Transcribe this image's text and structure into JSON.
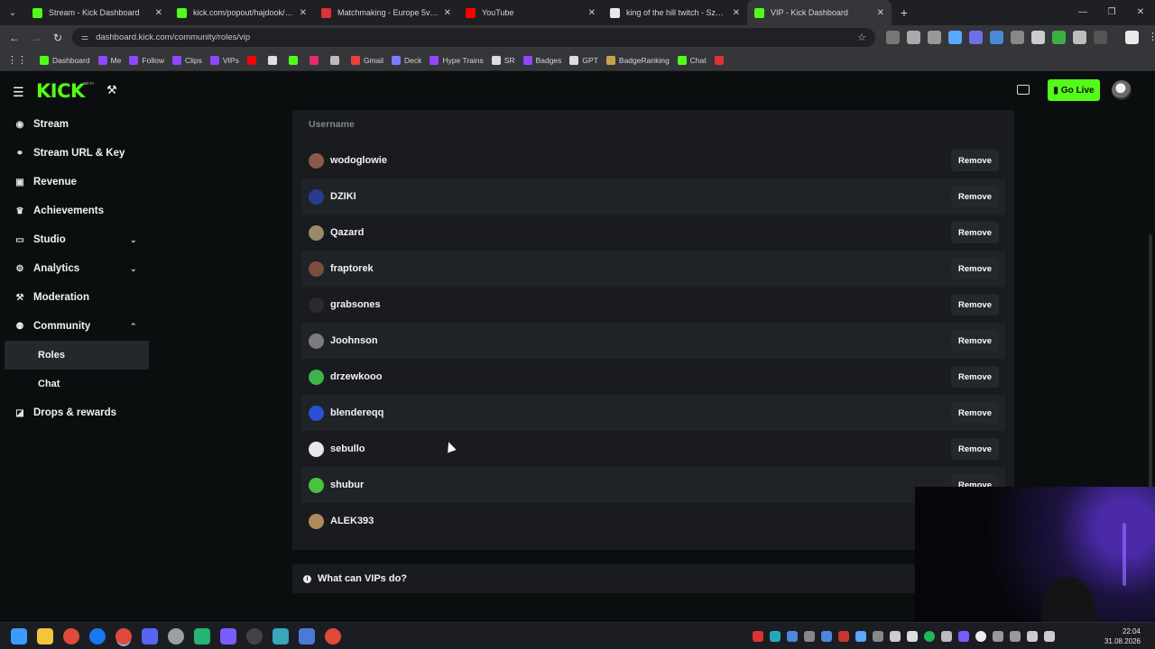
{
  "browser": {
    "tabs": [
      {
        "title": "Stream - Kick Dashboard",
        "color": "#53fc18",
        "active": false
      },
      {
        "title": "kick.com/popout/hajdook/chat",
        "color": "#53fc18",
        "active": false
      },
      {
        "title": "Matchmaking - Europe 5v5 Qu",
        "color": "#d33",
        "active": false
      },
      {
        "title": "YouTube",
        "color": "#ff0000",
        "active": false
      },
      {
        "title": "king of the hill twitch - Szukaj w",
        "color": "#e8e8e8",
        "active": false
      },
      {
        "title": "VIP - Kick Dashboard",
        "color": "#53fc18",
        "active": true
      }
    ],
    "url": "dashboard.kick.com/community/roles/vip",
    "bookmarks": [
      {
        "label": "Dashboard",
        "color": "#53fc18"
      },
      {
        "label": "Me",
        "color": "#9146ff"
      },
      {
        "label": "Follow",
        "color": "#9146ff"
      },
      {
        "label": "Clips",
        "color": "#9146ff"
      },
      {
        "label": "VIPs",
        "color": "#9146ff"
      },
      {
        "label": "",
        "color": "#ff0000"
      },
      {
        "label": "",
        "color": "#e0e0e0"
      },
      {
        "label": "",
        "color": "#53fc18"
      },
      {
        "label": "",
        "color": "#e1306c"
      },
      {
        "label": "",
        "color": "#bbbbbb"
      },
      {
        "label": "Gmail",
        "color": "#ea4335"
      },
      {
        "label": "Deck",
        "color": "#7b7bff"
      },
      {
        "label": "Hype Trains",
        "color": "#9146ff"
      },
      {
        "label": "SR",
        "color": "#dddddd"
      },
      {
        "label": "Badges",
        "color": "#9146ff"
      },
      {
        "label": "GPT",
        "color": "#dddddd"
      },
      {
        "label": "BadgeRanking",
        "color": "#c8a24a"
      },
      {
        "label": "Chat",
        "color": "#53fc18"
      },
      {
        "label": "",
        "color": "#d33"
      }
    ]
  },
  "kick": {
    "logo": "KICK",
    "beta": "BETA",
    "go_live": "Go Live",
    "sidebar": [
      {
        "label": "Stream",
        "icon": "◉",
        "name": "stream"
      },
      {
        "label": "Stream URL & Key",
        "icon": "⚭",
        "name": "stream-url-key"
      },
      {
        "label": "Revenue",
        "icon": "▣",
        "name": "revenue"
      },
      {
        "label": "Achievements",
        "icon": "♛",
        "name": "achievements"
      },
      {
        "label": "Studio",
        "icon": "▭",
        "name": "studio",
        "chevron": "⌄"
      },
      {
        "label": "Analytics",
        "icon": "⚙",
        "name": "analytics",
        "chevron": "⌄"
      },
      {
        "label": "Moderation",
        "icon": "⚒",
        "name": "moderation"
      },
      {
        "label": "Community",
        "icon": "⚉",
        "name": "community",
        "chevron": "⌃"
      }
    ],
    "community_sub": [
      {
        "label": "Roles",
        "active": true
      },
      {
        "label": "Chat",
        "active": false
      }
    ],
    "drops": {
      "label": "Drops & rewards",
      "icon": "◪"
    },
    "table": {
      "column_header": "Username",
      "remove_label": "Remove",
      "rows": [
        {
          "username": "wodoglowie",
          "avatar_color": "#8b5a4a"
        },
        {
          "username": "DZIKI",
          "avatar_color": "#2a3b8c"
        },
        {
          "username": "Qazard",
          "avatar_color": "#9a8a6a"
        },
        {
          "username": "fraptorek",
          "avatar_color": "#7a4e3e"
        },
        {
          "username": "grabsones",
          "avatar_color": "#2b2b2b"
        },
        {
          "username": "Joohnson",
          "avatar_color": "#7c7c7c"
        },
        {
          "username": "drzewkooo",
          "avatar_color": "#3bb54a"
        },
        {
          "username": "blendereqq",
          "avatar_color": "#2b50d8"
        },
        {
          "username": "sebullo",
          "avatar_color": "#e8e8e8"
        },
        {
          "username": "shubur",
          "avatar_color": "#49c23d"
        },
        {
          "username": "ALEK393",
          "avatar_color": "#b08a5a"
        }
      ]
    },
    "faq": "What can VIPs do?"
  },
  "taskbar": {
    "time": "22:04",
    "date": "31.08.2026"
  }
}
